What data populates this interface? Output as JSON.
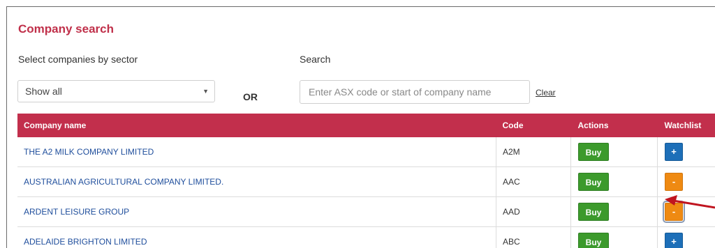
{
  "title": "Company search",
  "sector": {
    "label": "Select companies by sector",
    "selected": "Show all"
  },
  "or_label": "OR",
  "search": {
    "label": "Search",
    "placeholder": "Enter ASX code or start of company name",
    "clear_label": "Clear"
  },
  "table": {
    "headers": [
      "Company name",
      "Code",
      "Actions",
      "Watchlist"
    ],
    "rows": [
      {
        "name": "THE A2 MILK COMPANY LIMITED",
        "code": "A2M",
        "action": "Buy",
        "watch": "+"
      },
      {
        "name": "AUSTRALIAN AGRICULTURAL COMPANY LIMITED.",
        "code": "AAC",
        "action": "Buy",
        "watch": "-"
      },
      {
        "name": "ARDENT LEISURE GROUP",
        "code": "AAD",
        "action": "Buy",
        "watch": "-"
      },
      {
        "name": "ADELAIDE BRIGHTON LIMITED",
        "code": "ABC",
        "action": "Buy",
        "watch": "+"
      }
    ]
  },
  "colors": {
    "accent": "#c22f4c",
    "buy": "#3c9a2c",
    "watch_add": "#1d6fb8",
    "watch_remove": "#ef8a12",
    "annotation_arrow": "#c0141f"
  },
  "icons": {
    "select_caret": "caret-down-icon",
    "annotation": "red-arrow-icon"
  }
}
